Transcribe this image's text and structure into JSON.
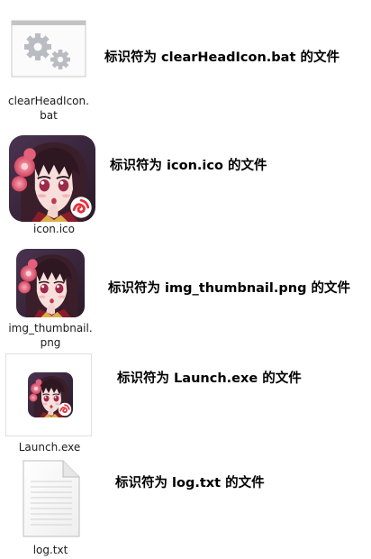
{
  "files": [
    {
      "file_name": "clearHeadIcon.bat",
      "file_name_line1": "clearHeadIcon.",
      "file_name_line2": "bat",
      "icon": "batch-file-gears-icon",
      "caption": "标识符为 clearHeadIcon.bat 的文件"
    },
    {
      "file_name": "icon.ico",
      "icon": "anime-girl-app-icon",
      "caption": "标识符为 icon.ico 的文件"
    },
    {
      "file_name": "img_thumbnail.png",
      "file_name_line1": "img_thumbnail.",
      "file_name_line2": "png",
      "icon": "anime-girl-thumbnail-icon",
      "caption": "标识符为 img_thumbnail.png 的文件"
    },
    {
      "file_name": "Launch.exe",
      "icon": "anime-girl-executable-icon",
      "caption": "标识符为 Launch.exe 的文件"
    },
    {
      "file_name": "log.txt",
      "icon": "text-document-icon",
      "caption": "标识符为 log.txt 的文件"
    }
  ],
  "colors": {
    "caption_text": "#000000",
    "file_name_text": "#1a1a1a",
    "gear_gray": "#b9bcc2",
    "badge_red": "#e8303a",
    "hair_dark": "#3a1e2a",
    "skin": "#f7e0dc",
    "flower_pink": "#e2607a"
  }
}
